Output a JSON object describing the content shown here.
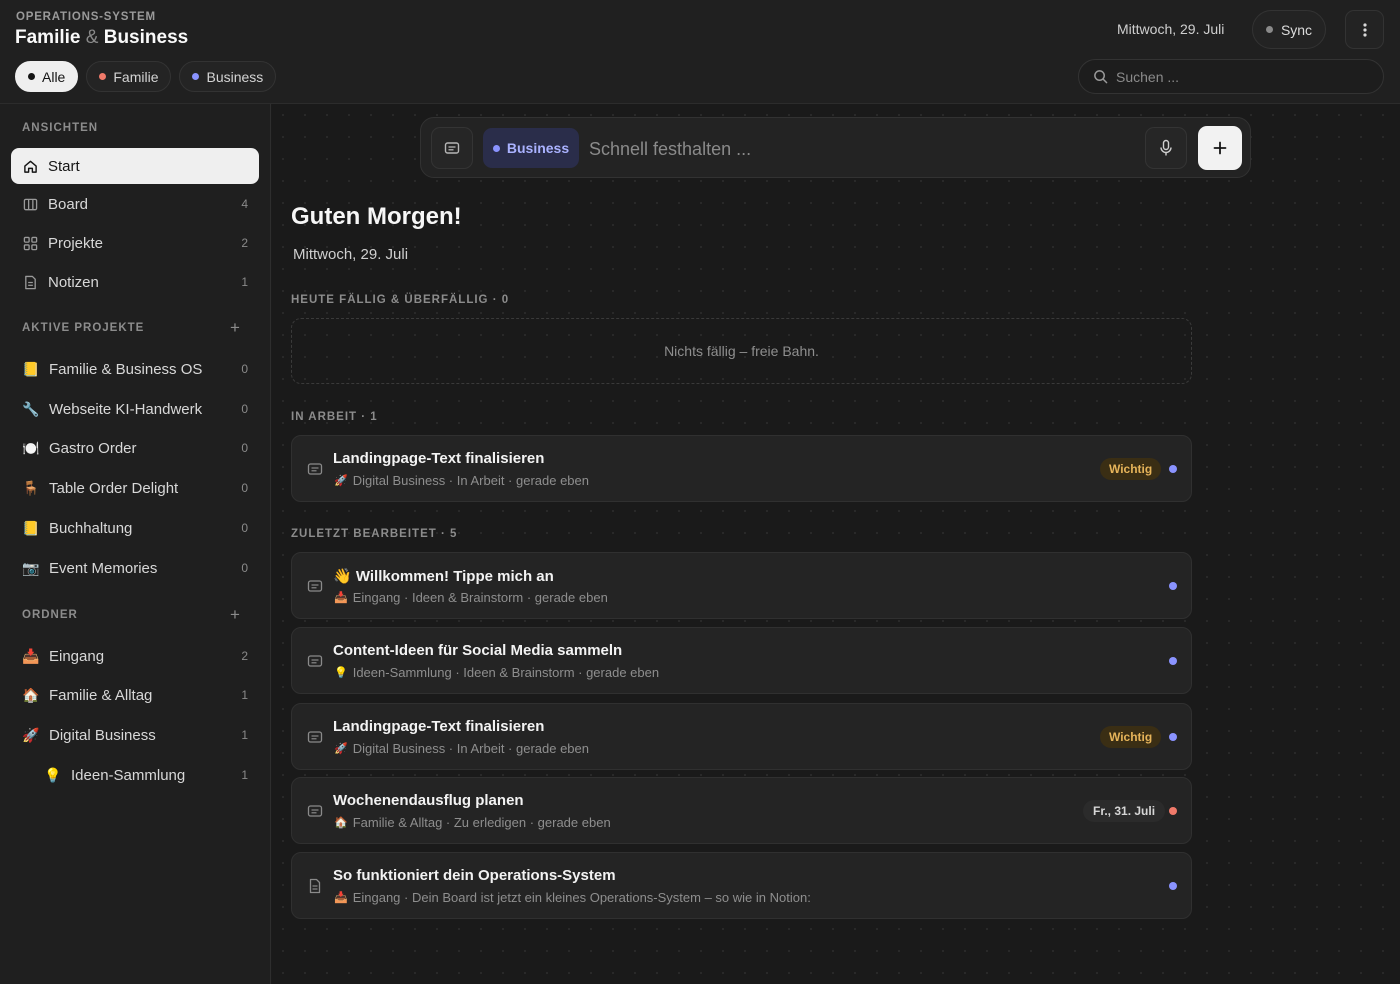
{
  "app": {
    "kicker": "OPERATIONS-SYSTEM",
    "title_a": "Familie",
    "title_amp": "&",
    "title_b": "Business",
    "date": "Mittwoch, 29. Juli",
    "sync_label": "Sync",
    "search_placeholder": "Suchen ...",
    "filters": [
      {
        "label": "Alle",
        "color": "#151515",
        "active": true
      },
      {
        "label": "Familie",
        "color": "#f07a6a",
        "active": false
      },
      {
        "label": "Business",
        "color": "#8a93ff",
        "active": false
      }
    ]
  },
  "sidebar": {
    "views_heading": "ANSICHTEN",
    "views": [
      {
        "label": "Start",
        "count": "",
        "icon": "home-icon",
        "active": true
      },
      {
        "label": "Board",
        "count": "4",
        "icon": "board-icon"
      },
      {
        "label": "Projekte",
        "count": "2",
        "icon": "grid-icon"
      },
      {
        "label": "Notizen",
        "count": "1",
        "icon": "note-icon"
      }
    ],
    "projects_heading": "AKTIVE PROJEKTE",
    "projects_plus": "+",
    "projects": [
      {
        "emoji": "📒",
        "label": "Familie & Business OS",
        "count": "0"
      },
      {
        "emoji": "🔧",
        "label": "Webseite KI-Handwerk",
        "count": "0"
      },
      {
        "emoji": "🍽️",
        "label": "Gastro Order",
        "count": "0"
      },
      {
        "emoji": "🪑",
        "label": "Table Order Delight",
        "count": "0"
      },
      {
        "emoji": "📒",
        "label": "Buchhaltung",
        "count": "0"
      },
      {
        "emoji": "📷",
        "label": "Event Memories",
        "count": "0"
      }
    ],
    "folders_heading": "ORDNER",
    "folders_plus": "+",
    "folders": [
      {
        "emoji": "📥",
        "label": "Eingang",
        "count": "2"
      },
      {
        "emoji": "🏠",
        "label": "Familie & Alltag",
        "count": "1"
      },
      {
        "emoji": "🚀",
        "label": "Digital Business",
        "count": "1"
      },
      {
        "emoji": "💡",
        "label": "Ideen-Sammlung",
        "count": "1"
      }
    ]
  },
  "capture": {
    "tag_label": "Business",
    "placeholder": "Schnell festhalten ..."
  },
  "main": {
    "greeting": "Guten Morgen!",
    "date": "Mittwoch, 29. Juli",
    "due_heading": "HEUTE FÄLLIG & ÜBERFÄLLIG",
    "due_count": "· 0",
    "due_empty": "Nichts fällig – freie Bahn.",
    "work_heading": "IN ARBEIT",
    "work_count": "· 1",
    "recent_heading": "ZULETZT BEARBEITET",
    "recent_count": "· 5",
    "work_cards": [
      {
        "title": "Landingpage-Text finalisieren",
        "emoji": "🚀",
        "meta": "Digital Business · In Arbeit · gerade eben",
        "badge": "Wichtig",
        "badge_type": "important",
        "dot": "#8a93ff",
        "icon": "note-icon"
      }
    ],
    "recent_cards": [
      {
        "title": "👋 Willkommen! Tippe mich an",
        "emoji": "📥",
        "meta": "Eingang · Ideen & Brainstorm · gerade eben",
        "badge": "",
        "badge_type": "",
        "dot": "#8a93ff",
        "icon": "note-icon"
      },
      {
        "title": "Content-Ideen für Social Media sammeln",
        "emoji": "💡",
        "meta": "Ideen-Sammlung · Ideen & Brainstorm · gerade eben",
        "badge": "",
        "badge_type": "",
        "dot": "#8a93ff",
        "icon": "note-icon"
      },
      {
        "title": "Landingpage-Text finalisieren",
        "emoji": "🚀",
        "meta": "Digital Business · In Arbeit · gerade eben",
        "badge": "Wichtig",
        "badge_type": "important",
        "dot": "#8a93ff",
        "icon": "note-icon"
      },
      {
        "title": "Wochenendausflug planen",
        "emoji": "🏠",
        "meta": "Familie & Alltag · Zu erledigen · gerade eben",
        "badge": "Fr., 31. Juli",
        "badge_type": "date",
        "dot": "#f07a6a",
        "icon": "note-icon"
      },
      {
        "title": "So funktioniert dein Operations-System",
        "emoji": "📥",
        "meta": "Eingang · Dein Board ist jetzt ein kleines Operations-System – so wie in Notion:",
        "badge": "",
        "badge_type": "",
        "dot": "#8a93ff",
        "icon": "document-icon"
      }
    ]
  }
}
